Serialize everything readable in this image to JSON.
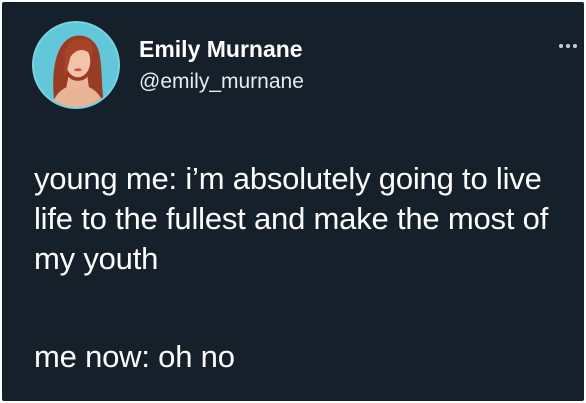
{
  "author": {
    "display_name": "Emily Murnane",
    "handle": "@emily_murnane",
    "avatar_icon": "profile-photo"
  },
  "header": {
    "more_icon": "more-options-icon"
  },
  "tweet": {
    "line1": "young me: i’m absolutely going to live life to the fullest and make the most of my youth",
    "line2": "me now: oh no"
  },
  "colors": {
    "background": "#15202b",
    "text": "#ffffff",
    "avatar_bg": "#5fc4d6"
  }
}
